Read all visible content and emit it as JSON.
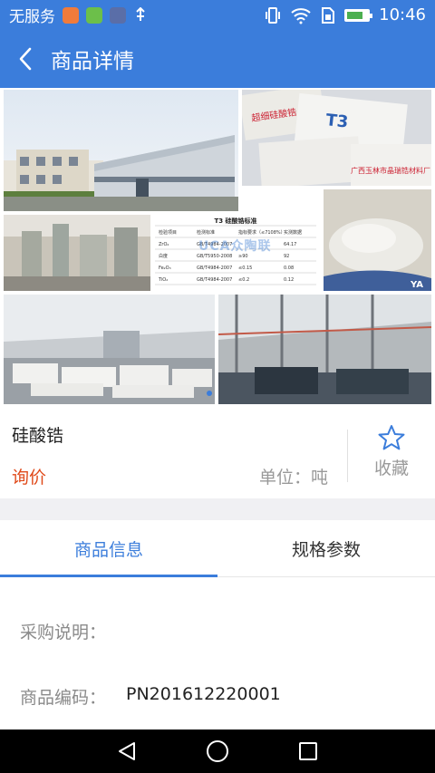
{
  "status_bar": {
    "carrier": "无服务",
    "time": "10:46",
    "battery_level": 0.7
  },
  "header": {
    "title": "商品详情"
  },
  "gallery": {
    "brand_watermark": "UCA众陶联",
    "spec_table": {
      "title": "T3 硅酸锆标准",
      "headers": [
        "检验项目",
        "检测标准",
        "指标要求（≤7108%）",
        "实测数据"
      ],
      "rows": [
        [
          "ZrO₂",
          "GB/T4984-2007",
          "",
          "64.17"
        ],
        [
          "白度",
          "GB/T5950-2008",
          "≥90",
          "92"
        ],
        [
          "Fe₂O₃",
          "GB/T4984-2007",
          "≤0.15",
          "0.08"
        ],
        [
          "TiO₂",
          "GB/T4984-2007",
          "≤0.2",
          "0.12"
        ]
      ]
    }
  },
  "product": {
    "name": "硅酸锆",
    "price": "询价",
    "unit": "单位：吨",
    "favorite_label": "收藏"
  },
  "tabs": [
    {
      "label": "商品信息",
      "active": true
    },
    {
      "label": "规格参数",
      "active": false
    }
  ],
  "detail": {
    "purchase_label": "采购说明：",
    "purchase_value": "",
    "code_label": "商品编码：",
    "code_value": "PN201612220001"
  },
  "colors": {
    "primary": "#3b7ddb",
    "price": "#e04a1a"
  }
}
